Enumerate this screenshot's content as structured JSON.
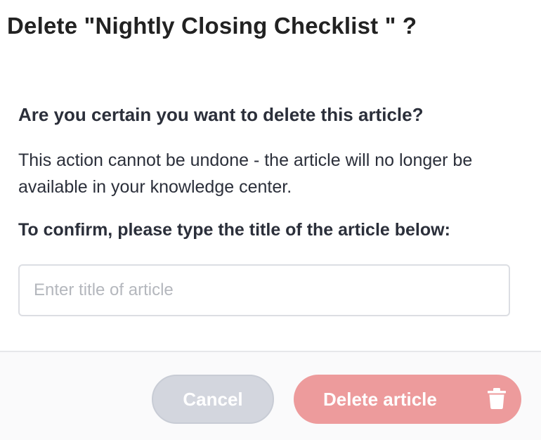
{
  "dialog": {
    "title": "Delete \"Nightly Closing Checklist \" ?",
    "question": "Are you certain you want to delete this article?",
    "warning": "This action cannot be undone - the article will no longer be available in your knowledge center.",
    "confirm_label": "To confirm, please type the title of the article below:",
    "input": {
      "placeholder": "Enter title of article",
      "value": ""
    }
  },
  "footer": {
    "cancel_label": "Cancel",
    "delete_label": "Delete article",
    "delete_icon": "trash-icon"
  },
  "colors": {
    "delete_button": "#ed9b9c",
    "cancel_button": "#d3d6de",
    "text": "#2b2f3a"
  }
}
